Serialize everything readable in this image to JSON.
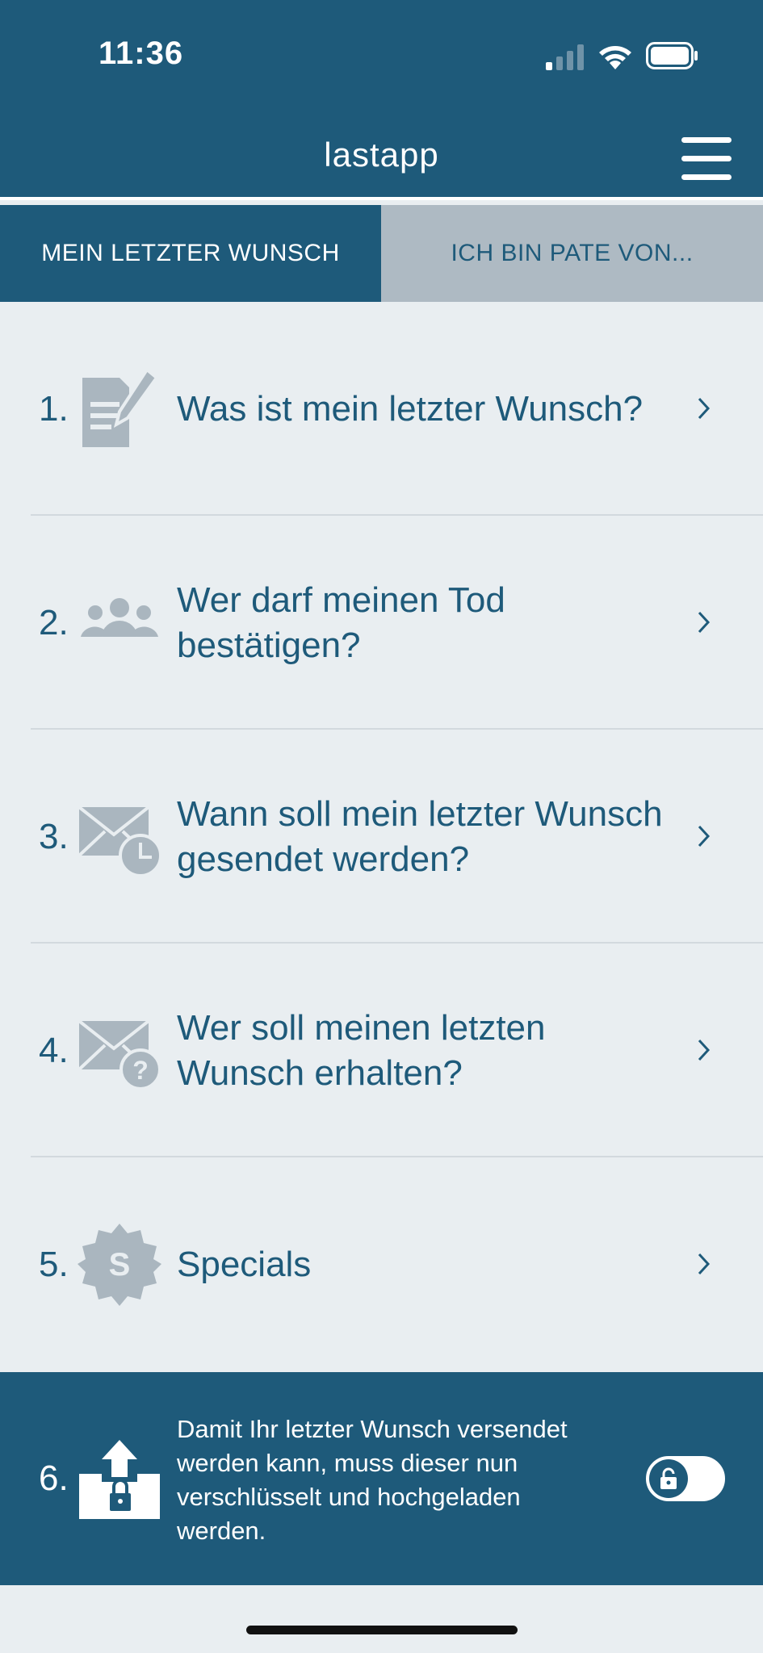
{
  "status": {
    "time": "11:36"
  },
  "header": {
    "title": "lastapp"
  },
  "tabs": [
    {
      "label": "MEIN LETZTER WUNSCH"
    },
    {
      "label": "ICH BIN PATE VON..."
    }
  ],
  "steps": [
    {
      "num": "1.",
      "label": "Was ist mein letzter Wunsch?",
      "icon": "document-edit-icon"
    },
    {
      "num": "2.",
      "label": "Wer darf meinen Tod bestätigen?",
      "icon": "people-group-icon"
    },
    {
      "num": "3.",
      "label": "Wann soll mein letzter Wunsch gesendet werden?",
      "icon": "mail-clock-icon"
    },
    {
      "num": "4.",
      "label": "Wer soll meinen letzten Wunsch erhalten?",
      "icon": "mail-question-icon"
    },
    {
      "num": "5.",
      "label": "Specials",
      "icon": "specials-badge-icon"
    }
  ],
  "upload": {
    "num": "6.",
    "text": "Damit Ihr letzter Wunsch versendet werden kann, muss dieser nun verschlüsselt und hochgeladen werden.",
    "icon": "encrypt-upload-icon"
  },
  "colors": {
    "primary": "#1e5a7a",
    "background": "#e9eef1",
    "tab_inactive": "#aebac3",
    "icon_gray": "#aab6bf"
  }
}
